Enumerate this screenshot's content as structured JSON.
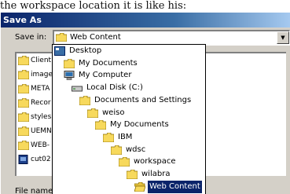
{
  "caption": "the workspace location it is like his:",
  "dialog": {
    "title": "Save As",
    "save_in_label": "Save in:",
    "save_in_value": "Web Content",
    "file_name_label": "File name"
  },
  "files": [
    {
      "label": "Client",
      "icon": "folder-icon"
    },
    {
      "label": "image",
      "icon": "folder-icon"
    },
    {
      "label": "META",
      "icon": "folder-icon"
    },
    {
      "label": "Recor",
      "icon": "folder-icon"
    },
    {
      "label": "styles",
      "icon": "folder-icon"
    },
    {
      "label": "UEMN",
      "icon": "folder-icon"
    },
    {
      "label": "WEB-",
      "icon": "folder-icon"
    },
    {
      "label": "cut02",
      "icon": "file-icon"
    }
  ],
  "tree": [
    {
      "label": "Desktop",
      "icon": "desktop-icon",
      "depth": 0,
      "selected": false
    },
    {
      "label": "My Documents",
      "icon": "folder-icon",
      "depth": 1,
      "selected": false
    },
    {
      "label": "My Computer",
      "icon": "computer-icon",
      "depth": 1,
      "selected": false
    },
    {
      "label": "Local Disk (C:)",
      "icon": "drive-icon",
      "depth": 2,
      "selected": false
    },
    {
      "label": "Documents and Settings",
      "icon": "folder-icon",
      "depth": 3,
      "selected": false
    },
    {
      "label": "weiso",
      "icon": "folder-icon",
      "depth": 4,
      "selected": false
    },
    {
      "label": "My Documents",
      "icon": "folder-icon",
      "depth": 5,
      "selected": false
    },
    {
      "label": "IBM",
      "icon": "folder-icon",
      "depth": 6,
      "selected": false
    },
    {
      "label": "wdsc",
      "icon": "folder-icon",
      "depth": 7,
      "selected": false
    },
    {
      "label": "workspace",
      "icon": "folder-icon",
      "depth": 8,
      "selected": false
    },
    {
      "label": "wilabra",
      "icon": "folder-icon",
      "depth": 9,
      "selected": false
    },
    {
      "label": "Web Content",
      "icon": "open-folder-icon",
      "depth": 10,
      "selected": true
    }
  ]
}
